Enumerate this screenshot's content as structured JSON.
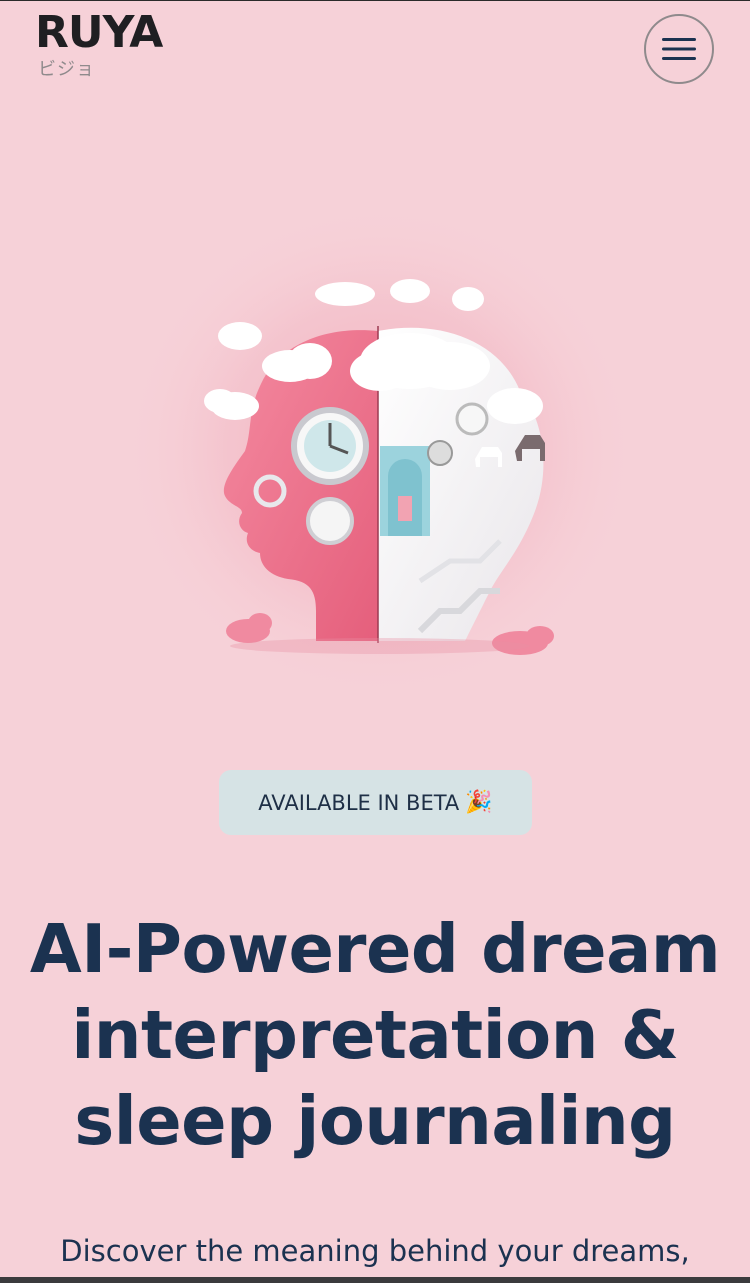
{
  "header": {
    "logo_main": "RUYA",
    "logo_sub": "ビジョ",
    "menu_icon": "hamburger-menu-icon"
  },
  "hero_image": {
    "icon": "dream-head-illustration"
  },
  "badge": {
    "label": "AVAILABLE IN BETA",
    "emoji": "🎉"
  },
  "headline": {
    "text": "AI-Powered dream interpretation & sleep journaling"
  },
  "subtext": {
    "text": "Discover the meaning behind your dreams,"
  },
  "colors": {
    "background": "#f6d1d8",
    "headline": "#1b3250",
    "badge_bg": "#d6e3e5",
    "logo": "#1f1f22"
  }
}
